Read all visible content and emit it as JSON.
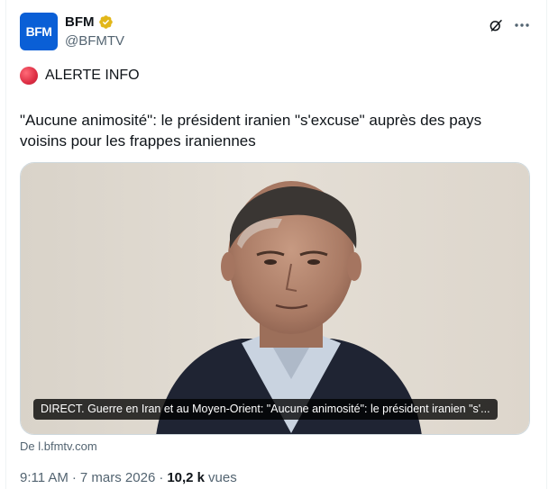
{
  "author": {
    "avatar_text": "BFM",
    "display_name": "BFM",
    "handle": "@BFMTV",
    "verified": true
  },
  "alert": {
    "label": "ALERTE INFO",
    "dot_color": "#dd2e44"
  },
  "tweet": {
    "text": "\"Aucune animosité\": le président iranien \"s'excuse\" auprès des pays voisins pour les frappes iraniennes"
  },
  "card": {
    "caption": "DIRECT. Guerre en Iran et au Moyen-Orient: \"Aucune animosité\": le président iranien \"s'...",
    "source": "De l.bfmtv.com"
  },
  "meta": {
    "time": "9:11 AM",
    "sep1": "·",
    "date": "7 mars 2026",
    "sep2": "·",
    "views_count": "10,2 k",
    "views_label": "vues"
  },
  "icons": {
    "grok": "grok-icon",
    "more": "more-icon",
    "verified": "verified-badge-icon"
  },
  "colors": {
    "brand": "#0a5fd6",
    "verified_gold": "#e2b719",
    "secondary_text": "#536471"
  }
}
